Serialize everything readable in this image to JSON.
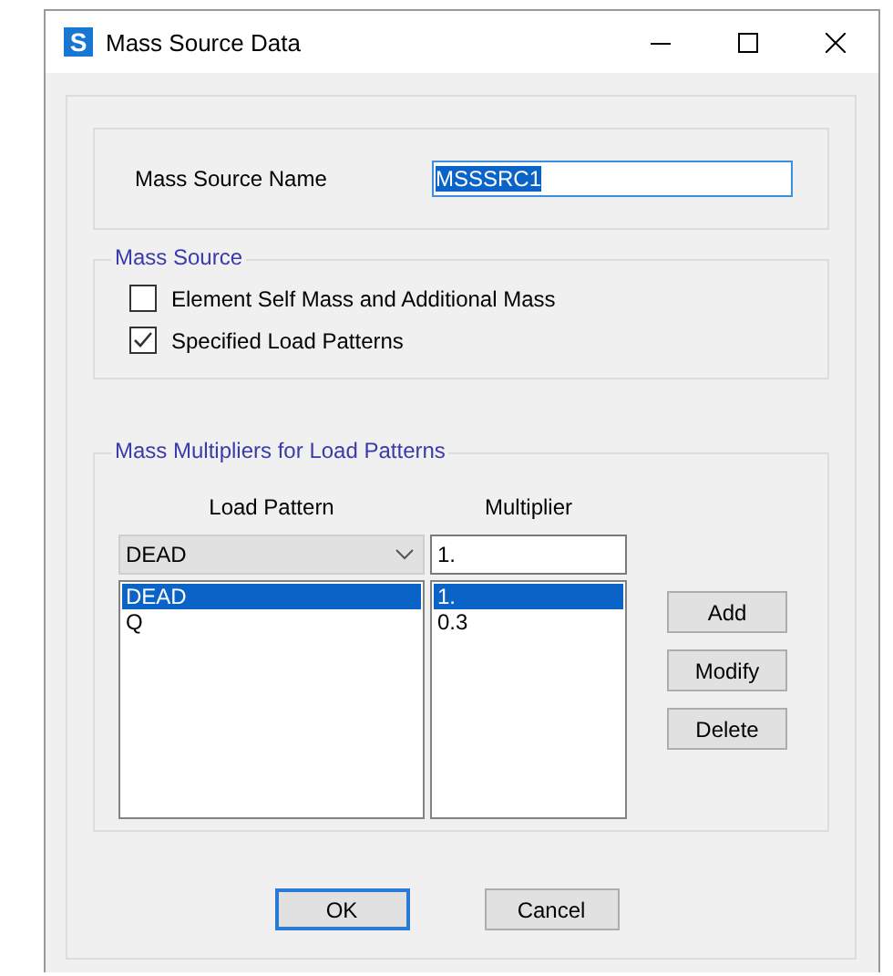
{
  "window": {
    "title": "Mass Source Data",
    "app_icon": "S"
  },
  "mass_source_name": {
    "label": "Mass Source Name",
    "value": "MSSSRC1",
    "text_selected": true
  },
  "mass_source": {
    "title": "Mass Source",
    "options": [
      {
        "label": "Element Self Mass and Additional Mass",
        "checked": false
      },
      {
        "label": "Specified Load Patterns",
        "checked": true
      }
    ]
  },
  "multipliers": {
    "title": "Mass Multipliers for Load Patterns",
    "columns": [
      "Load Pattern",
      "Multiplier"
    ],
    "load_pattern_select": "DEAD",
    "multiplier_input": "1.",
    "rows": [
      {
        "load_pattern": "DEAD",
        "multiplier": "1.",
        "selected": true
      },
      {
        "load_pattern": "Q",
        "multiplier": "0.3",
        "selected": false
      }
    ],
    "buttons": [
      "Add",
      "Modify",
      "Delete"
    ]
  },
  "buttons": [
    {
      "label": "OK",
      "default": true
    },
    {
      "label": "Cancel",
      "default": false
    }
  ]
}
